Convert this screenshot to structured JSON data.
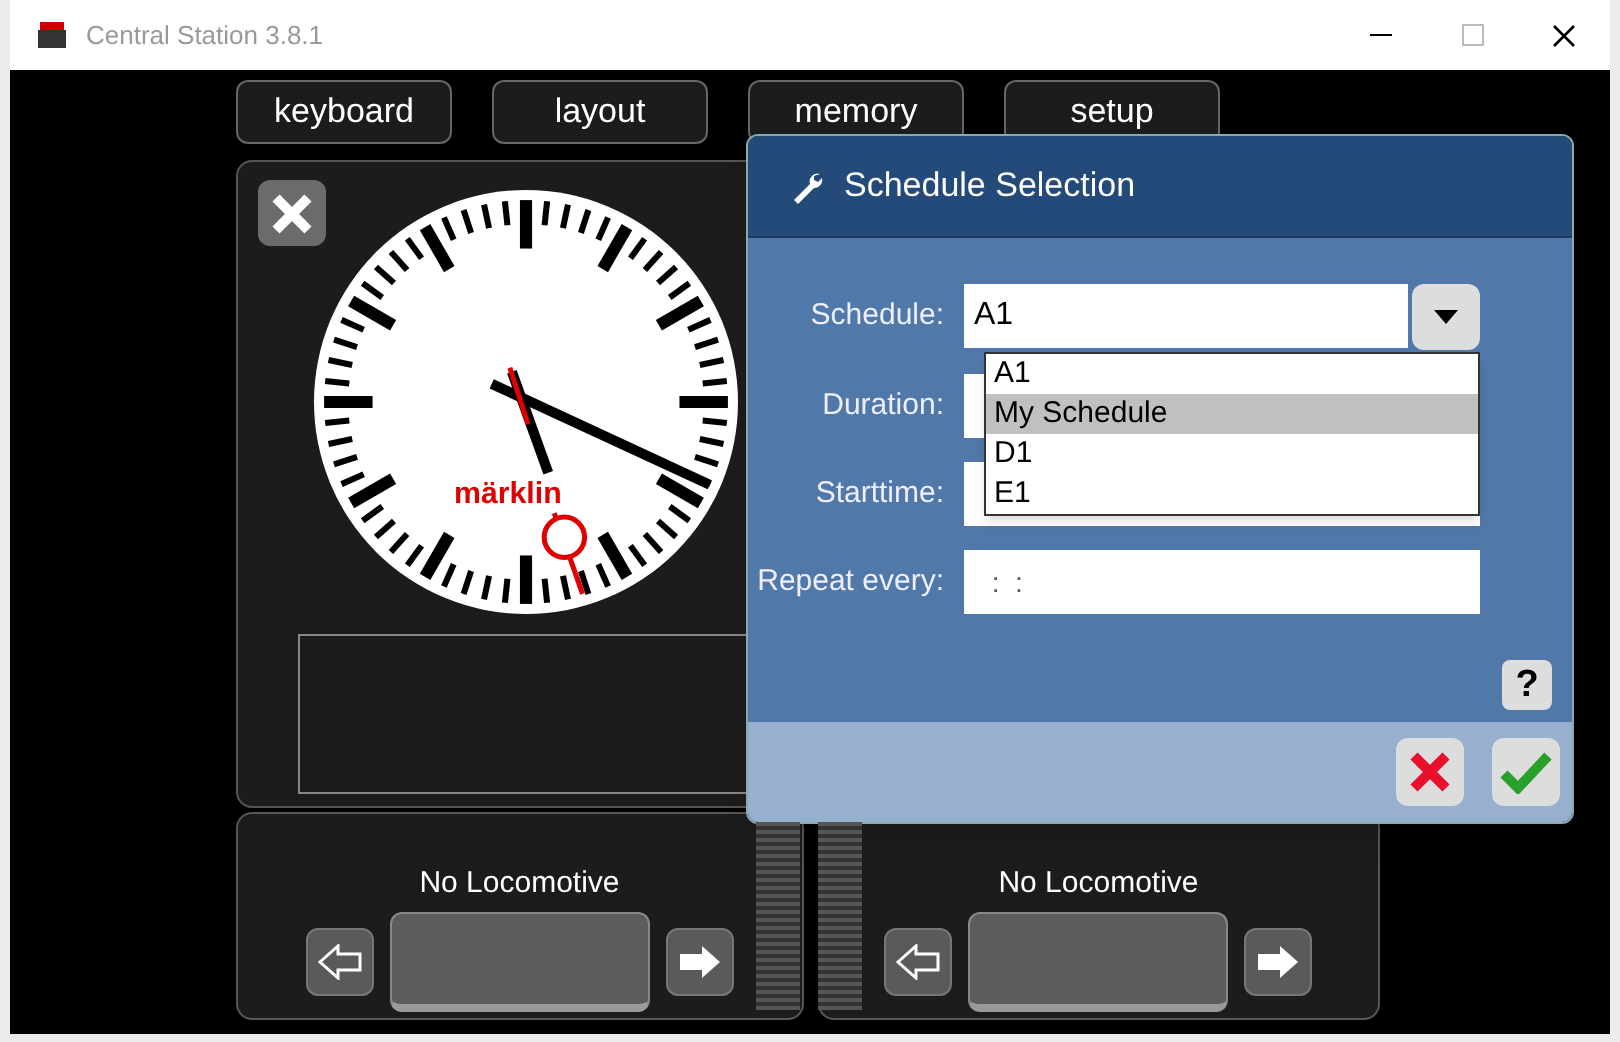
{
  "window": {
    "title": "Central Station 3.8.1"
  },
  "nav_buttons": [
    "keyboard",
    "layout",
    "memory",
    "setup"
  ],
  "clock": {
    "logo": "märklin"
  },
  "dialog": {
    "title": "Schedule Selection",
    "help": "?",
    "fields": [
      {
        "label": "Schedule:",
        "kind": "select",
        "value": "A1"
      },
      {
        "label": "Duration:",
        "kind": "text"
      },
      {
        "label": "Starttime:",
        "kind": "text"
      },
      {
        "label": "Repeat every:",
        "kind": "text",
        "value": " :  :"
      }
    ],
    "dropdown": [
      {
        "label": "A1",
        "selected": false
      },
      {
        "label": "My Schedule",
        "selected": true
      },
      {
        "label": "D1",
        "selected": false
      },
      {
        "label": "E1",
        "selected": false
      }
    ]
  },
  "controllers": [
    {
      "name": "No Locomotive",
      "level": 0
    },
    {
      "name": "No Locomotive",
      "level": 0
    }
  ]
}
